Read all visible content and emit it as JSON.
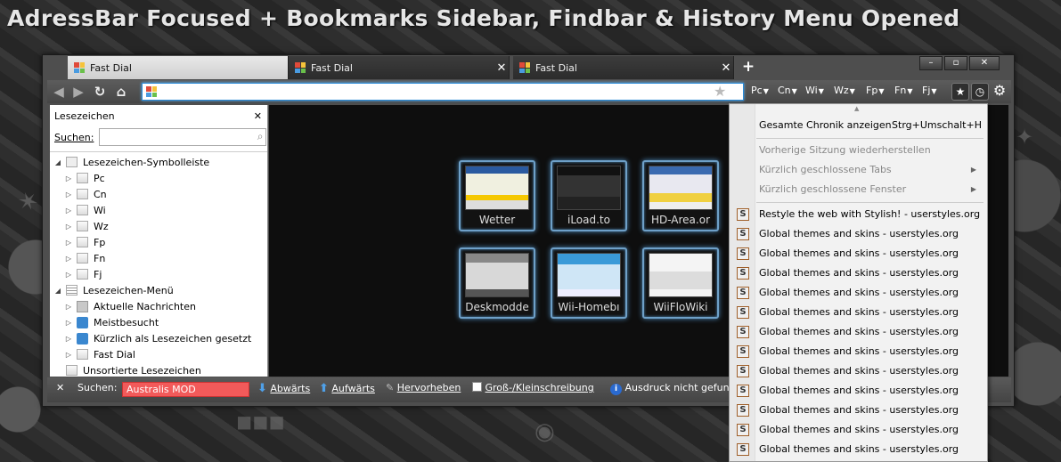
{
  "headline": "AdressBar Focused + Bookmarks Sidebar, Findbar & History Menu Opened",
  "tabs": [
    {
      "label": "Fast Dial",
      "active": true
    },
    {
      "label": "Fast Dial",
      "active": false
    },
    {
      "label": "Fast Dial",
      "active": false
    }
  ],
  "tab_close_glyph": "✕",
  "new_tab_glyph": "+",
  "window_controls": [
    "–",
    "▫",
    "✕"
  ],
  "urlbar": {
    "value": "",
    "placeholder": ""
  },
  "bookmarks_toolbar": [
    "Pc",
    "Cn",
    "Wi",
    "Wz",
    "Fp",
    "Fn",
    "Fj"
  ],
  "sidebar": {
    "title": "Lesezeichen",
    "search_label": "Suchen:",
    "search_value": "",
    "tree": {
      "symbol_bar": "Lesezeichen-Symbolleiste",
      "symbol_children": [
        "Pc",
        "Cn",
        "Wi",
        "Wz",
        "Fp",
        "Fn",
        "Fj"
      ],
      "menu": "Lesezeichen-Menü",
      "menu_children": [
        "Aktuelle Nachrichten",
        "Meistbesucht",
        "Kürzlich als Lesezeichen gesetzt",
        "Fast Dial"
      ],
      "unsorted": "Unsortierte Lesezeichen"
    }
  },
  "dials": [
    {
      "label": "Wetter"
    },
    {
      "label": "iLoad.to"
    },
    {
      "label": "HD-Area.or"
    },
    {
      "label": "Deskmodde"
    },
    {
      "label": "Wii-Homebı"
    },
    {
      "label": "WiiFloWiki"
    }
  ],
  "findbar": {
    "label": "Suchen:",
    "value": "Australis MOD",
    "down": "Abwärts",
    "up": "Aufwärts",
    "highlight": "Hervorheben",
    "case": "Groß-/Kleinschreibung",
    "status": "Ausdruck nicht gefun"
  },
  "history_menu": {
    "show_all": "Gesamte Chronik anzeigen",
    "show_all_shortcut": "Strg+Umschalt+H",
    "restore_session": "Vorherige Sitzung wiederherstellen",
    "recent_tabs": "Kürzlich geschlossene Tabs",
    "recent_windows": "Kürzlich geschlossene Fenster",
    "entries": [
      "Restyle the web with Stylish! - userstyles.org",
      "Global themes and skins - userstyles.org",
      "Global themes and skins - userstyles.org",
      "Global themes and skins - userstyles.org",
      "Global themes and skins - userstyles.org",
      "Global themes and skins - userstyles.org",
      "Global themes and skins - userstyles.org",
      "Global themes and skins - userstyles.org",
      "Global themes and skins - userstyles.org",
      "Global themes and skins - userstyles.org",
      "Global themes and skins - userstyles.org",
      "Global themes and skins - userstyles.org",
      "Global themes and skins - userstyles.org"
    ]
  },
  "colors": {
    "urlbar_focus": "#2a8bd8",
    "find_not_found": "#f25a5a",
    "dial_glow": "#6ea0c8"
  }
}
